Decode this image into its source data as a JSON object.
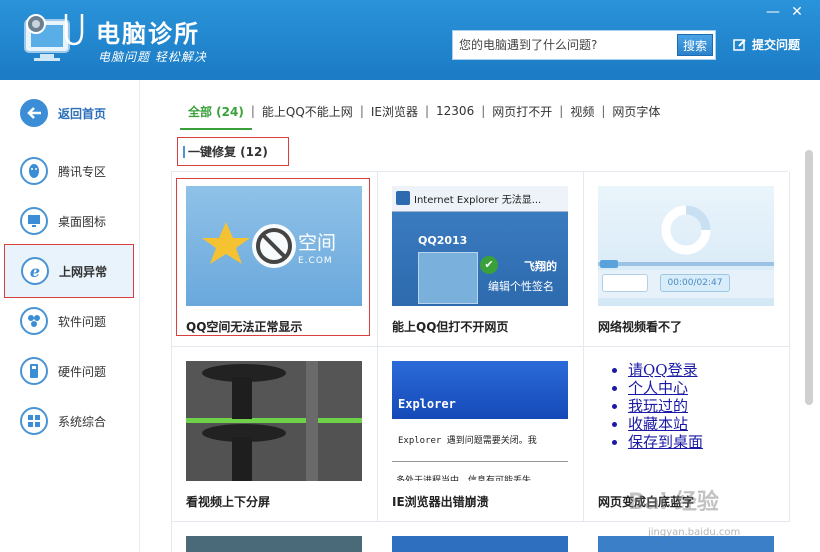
{
  "header": {
    "app_title": "电脑诊所",
    "app_slogan": "电脑问题 轻松解决",
    "search_placeholder": "您的电脑遇到了什么问题?",
    "search_button": "搜索",
    "feedback_label": "提交问题",
    "window_controls": [
      "—",
      "✕"
    ]
  },
  "sidebar": {
    "items": [
      {
        "label": "返回首页",
        "icon": "back-arrow-icon"
      },
      {
        "label": "腾讯专区",
        "icon": "qq-penguin-icon"
      },
      {
        "label": "桌面图标",
        "icon": "monitor-icon"
      },
      {
        "label": "上网异常",
        "icon": "ie-icon",
        "active": true
      },
      {
        "label": "软件问题",
        "icon": "software-icon"
      },
      {
        "label": "硬件问题",
        "icon": "usb-icon"
      },
      {
        "label": "系统综合",
        "icon": "windows-icon"
      }
    ]
  },
  "filters": [
    {
      "label": "全部 (24)",
      "active": true
    },
    {
      "label": "能上QQ不能上网"
    },
    {
      "label": "IE浏览器"
    },
    {
      "label": "12306"
    },
    {
      "label": "网页打不开"
    },
    {
      "label": "视频"
    },
    {
      "label": "网页字体"
    }
  ],
  "section_title": "一键修复 (12)",
  "cards": [
    {
      "caption": "QQ空间无法正常显示",
      "thumb": {
        "brand": "空间",
        "domain": "E.COM"
      }
    },
    {
      "caption": "能上QQ但打不开网页",
      "thumb": {
        "tab": "Internet Explorer 无法显...",
        "qq": "QQ2013",
        "name": "飞翔的",
        "sig": "编辑个性签名"
      }
    },
    {
      "caption": "网络视频看不了",
      "thumb": {
        "time": "00:00/02:47"
      }
    },
    {
      "caption": "看视频上下分屏"
    },
    {
      "caption": "IE浏览器出错崩溃",
      "thumb": {
        "title": "Explorer",
        "msg": "Explorer 遇到问题需要关闭。我",
        "msg2": "多处于进程当中，信息有可能丢失"
      }
    },
    {
      "caption": "网页变成白底蓝字",
      "thumb": {
        "links": [
          "请QQ登录",
          "个人中心",
          "我玩过的",
          "收藏本站",
          "保存到桌面"
        ]
      }
    }
  ],
  "watermark": {
    "text": "Bai 经验",
    "url": "jingyan.baidu.com"
  }
}
